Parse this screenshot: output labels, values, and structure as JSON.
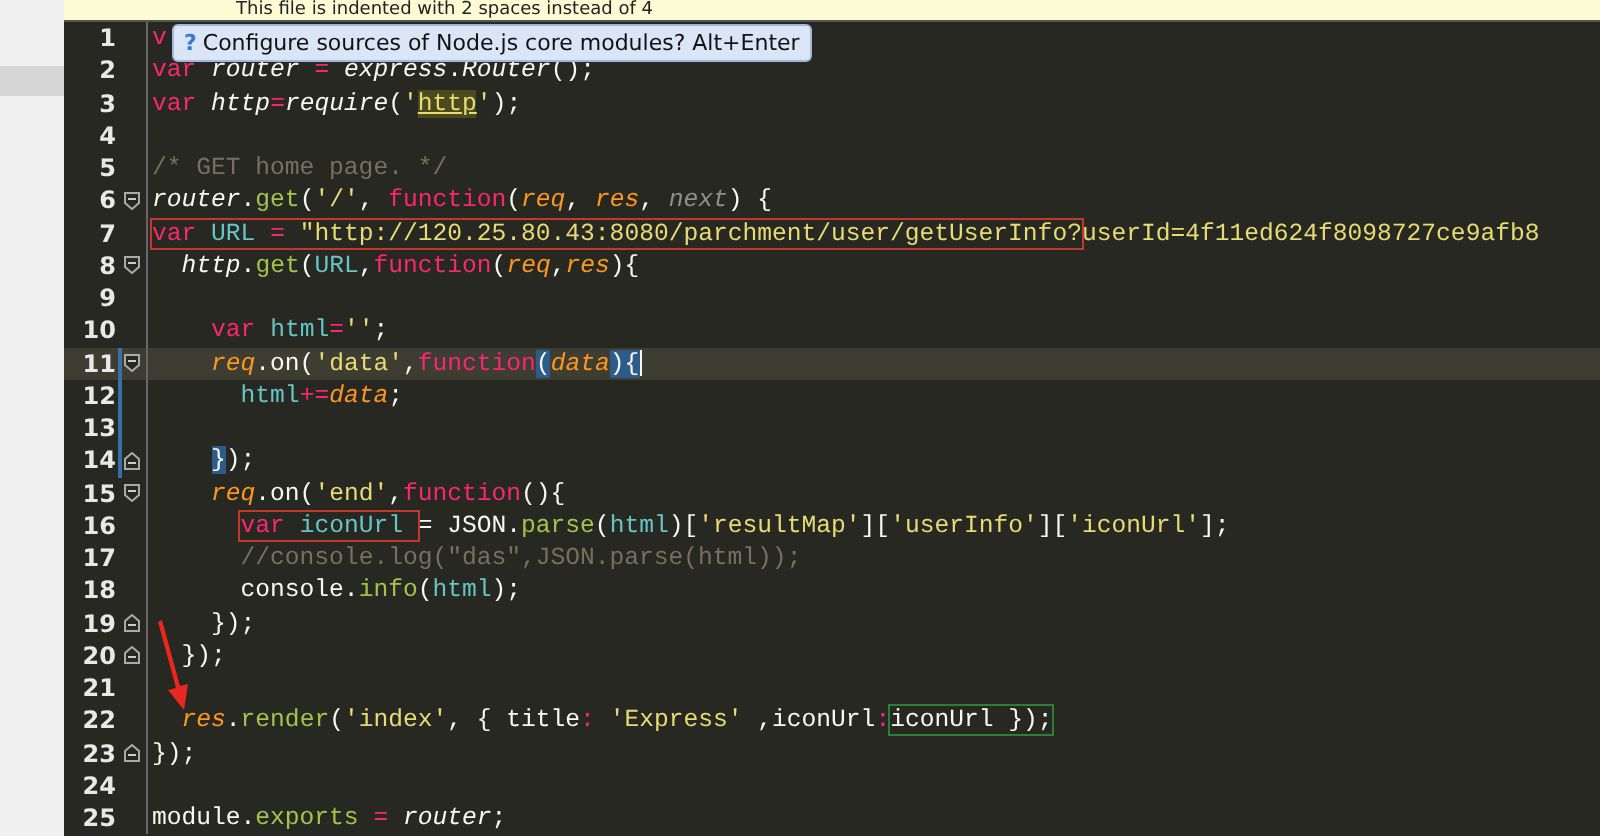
{
  "banner": {
    "text": "This file is indented with 2 spaces instead of 4"
  },
  "tooltip": {
    "icon": "?",
    "text": "Configure sources of Node.js core modules? Alt+Enter"
  },
  "lines": [
    {
      "number": "1",
      "current": false,
      "scope": false,
      "fold_open": false,
      "fold_close": false,
      "tokens": [
        {
          "kind": "kw",
          "text": "v"
        }
      ]
    },
    {
      "number": "2",
      "current": false,
      "scope": false,
      "fold_open": false,
      "fold_close": false,
      "tokens": [
        {
          "kind": "kw",
          "text": "var"
        },
        {
          "kind": "ivar",
          "text": " router"
        },
        {
          "kind": "op",
          "text": " ="
        },
        {
          "kind": "ivar",
          "text": " express"
        },
        {
          "kind": "plain",
          "text": "."
        },
        {
          "kind": "ivar",
          "text": "Router"
        },
        {
          "kind": "plain",
          "text": "();"
        }
      ]
    },
    {
      "number": "3",
      "current": false,
      "scope": false,
      "fold_open": false,
      "fold_close": false,
      "tokens": [
        {
          "kind": "kw",
          "text": "var"
        },
        {
          "kind": "ivar",
          "text": " http"
        },
        {
          "kind": "op",
          "text": "="
        },
        {
          "kind": "ivar",
          "text": "require"
        },
        {
          "kind": "plain",
          "text": "("
        },
        {
          "kind": "str",
          "text": "'"
        },
        {
          "kind": "usage",
          "text": "http"
        },
        {
          "kind": "str",
          "text": "'"
        },
        {
          "kind": "plain",
          "text": ");"
        }
      ]
    },
    {
      "number": "4",
      "current": false,
      "scope": false,
      "fold_open": false,
      "fold_close": false
    },
    {
      "number": "5",
      "current": false,
      "scope": false,
      "fold_open": false,
      "fold_close": false,
      "tokens": [
        {
          "kind": "cmt",
          "text": "/* GET home page. */"
        }
      ]
    },
    {
      "number": "6",
      "current": false,
      "scope": false,
      "fold_open": true,
      "fold_close": false,
      "tokens": [
        {
          "kind": "ivar",
          "text": "router"
        },
        {
          "kind": "plain",
          "text": "."
        },
        {
          "kind": "fn",
          "text": "get"
        },
        {
          "kind": "plain",
          "text": "("
        },
        {
          "kind": "str",
          "text": "'/'"
        },
        {
          "kind": "plain",
          "text": ", "
        },
        {
          "kind": "kw",
          "text": "function"
        },
        {
          "kind": "plain",
          "text": "("
        },
        {
          "kind": "param",
          "text": "req"
        },
        {
          "kind": "plain",
          "text": ", "
        },
        {
          "kind": "param",
          "text": "res"
        },
        {
          "kind": "plain",
          "text": ", "
        },
        {
          "kind": "unused",
          "text": "next"
        },
        {
          "kind": "plain",
          "text": ") {"
        }
      ]
    },
    {
      "number": "7",
      "current": false,
      "scope": false,
      "fold_open": false,
      "fold_close": false,
      "tokens": [
        {
          "kind": "box",
          "color": "#c0392b",
          "tokens": [
            {
              "kind": "kw",
              "text": "var"
            },
            {
              "kind": "var",
              "text": " URL"
            },
            {
              "kind": "op",
              "text": " ="
            },
            {
              "kind": "str",
              "text": " \"http://120.25.80.43:8080/parchment/user/getUserInfo?"
            }
          ]
        },
        {
          "kind": "str",
          "text": "userId=4f11ed624f8098727ce9afb8"
        }
      ]
    },
    {
      "number": "8",
      "current": false,
      "scope": false,
      "fold_open": true,
      "fold_close": false,
      "tokens": [
        {
          "kind": "ivar",
          "text": "  http"
        },
        {
          "kind": "plain",
          "text": "."
        },
        {
          "kind": "fn",
          "text": "get"
        },
        {
          "kind": "plain",
          "text": "("
        },
        {
          "kind": "var",
          "text": "URL"
        },
        {
          "kind": "plain",
          "text": ","
        },
        {
          "kind": "kw",
          "text": "function"
        },
        {
          "kind": "plain",
          "text": "("
        },
        {
          "kind": "param",
          "text": "req"
        },
        {
          "kind": "plain",
          "text": ","
        },
        {
          "kind": "param",
          "text": "res"
        },
        {
          "kind": "plain",
          "text": "){"
        }
      ]
    },
    {
      "number": "9",
      "current": false,
      "scope": false,
      "fold_open": false,
      "fold_close": false
    },
    {
      "number": "10",
      "current": false,
      "scope": false,
      "fold_open": false,
      "fold_close": false,
      "tokens": [
        {
          "kind": "kw",
          "text": "    var"
        },
        {
          "kind": "var",
          "text": " html"
        },
        {
          "kind": "op",
          "text": "="
        },
        {
          "kind": "str",
          "text": "''"
        },
        {
          "kind": "plain",
          "text": ";"
        }
      ]
    },
    {
      "number": "11",
      "current": true,
      "scope": true,
      "fold_open": true,
      "fold_close": false,
      "tokens": [
        {
          "kind": "param",
          "text": "    req"
        },
        {
          "kind": "plain",
          "text": ".on("
        },
        {
          "kind": "str",
          "text": "'data'"
        },
        {
          "kind": "plain",
          "text": ","
        },
        {
          "kind": "kw",
          "text": "function"
        },
        {
          "kind": "match",
          "text": "("
        },
        {
          "kind": "param",
          "text": "data"
        },
        {
          "kind": "match",
          "text": ")"
        },
        {
          "kind": "match",
          "text": "{"
        },
        {
          "kind": "caret"
        }
      ]
    },
    {
      "number": "12",
      "current": false,
      "scope": true,
      "fold_open": false,
      "fold_close": false,
      "tokens": [
        {
          "kind": "var",
          "text": "      html"
        },
        {
          "kind": "op",
          "text": "+="
        },
        {
          "kind": "param",
          "text": "data"
        },
        {
          "kind": "plain",
          "text": ";"
        }
      ]
    },
    {
      "number": "13",
      "current": false,
      "scope": true,
      "fold_open": false,
      "fold_close": false
    },
    {
      "number": "14",
      "current": false,
      "scope": true,
      "fold_open": false,
      "fold_close": true,
      "tokens": [
        {
          "kind": "match",
          "text": "    }"
        },
        {
          "kind": "plain",
          "text": ");"
        }
      ]
    },
    {
      "number": "15",
      "current": false,
      "scope": false,
      "fold_open": true,
      "fold_close": false,
      "tokens": [
        {
          "kind": "param",
          "text": "    req"
        },
        {
          "kind": "plain",
          "text": ".on("
        },
        {
          "kind": "str",
          "text": "'end'"
        },
        {
          "kind": "plain",
          "text": ","
        },
        {
          "kind": "kw",
          "text": "function"
        },
        {
          "kind": "plain",
          "text": "(){"
        }
      ]
    },
    {
      "number": "16",
      "current": false,
      "scope": false,
      "fold_open": false,
      "fold_close": false,
      "tokens": [
        {
          "kind": "box",
          "color": "#c0392b",
          "tokens": [
            {
              "kind": "kw",
              "text": "      var"
            },
            {
              "kind": "var",
              "text": " iconUrl "
            }
          ]
        },
        {
          "kind": "plain",
          "text": "= JSON."
        },
        {
          "kind": "fn",
          "text": "parse"
        },
        {
          "kind": "plain",
          "text": "("
        },
        {
          "kind": "var",
          "text": "html"
        },
        {
          "kind": "plain",
          "text": ")["
        },
        {
          "kind": "str",
          "text": "'resultMap'"
        },
        {
          "kind": "plain",
          "text": "]["
        },
        {
          "kind": "str",
          "text": "'userInfo'"
        },
        {
          "kind": "plain",
          "text": "]["
        },
        {
          "kind": "str",
          "text": "'iconUrl'"
        },
        {
          "kind": "plain",
          "text": "];"
        }
      ]
    },
    {
      "number": "17",
      "current": false,
      "scope": false,
      "fold_open": false,
      "fold_close": false,
      "tokens": [
        {
          "kind": "cmt",
          "text": "      //console.log(\"das\",JSON.parse(html));"
        }
      ]
    },
    {
      "number": "18",
      "current": false,
      "scope": false,
      "fold_open": false,
      "fold_close": false,
      "tokens": [
        {
          "kind": "plain",
          "text": "      console."
        },
        {
          "kind": "fn",
          "text": "info"
        },
        {
          "kind": "plain",
          "text": "("
        },
        {
          "kind": "var",
          "text": "html"
        },
        {
          "kind": "plain",
          "text": ");"
        }
      ]
    },
    {
      "number": "19",
      "current": false,
      "scope": false,
      "fold_open": false,
      "fold_close": true,
      "tokens": [
        {
          "kind": "plain",
          "text": "    });"
        }
      ]
    },
    {
      "number": "20",
      "current": false,
      "scope": false,
      "fold_open": false,
      "fold_close": true,
      "tokens": [
        {
          "kind": "plain",
          "text": "  });"
        }
      ]
    },
    {
      "number": "21",
      "current": false,
      "scope": false,
      "fold_open": false,
      "fold_close": false
    },
    {
      "number": "22",
      "current": false,
      "scope": false,
      "fold_open": false,
      "fold_close": false,
      "tokens": [
        {
          "kind": "param",
          "text": "  res"
        },
        {
          "kind": "plain",
          "text": "."
        },
        {
          "kind": "fn",
          "text": "render"
        },
        {
          "kind": "plain",
          "text": "("
        },
        {
          "kind": "str",
          "text": "'index'"
        },
        {
          "kind": "plain",
          "text": ", { title"
        },
        {
          "kind": "op",
          "text": ":"
        },
        {
          "kind": "str",
          "text": " 'Express'"
        },
        {
          "kind": "plain",
          "text": " ,iconUrl"
        },
        {
          "kind": "op",
          "text": ":"
        },
        {
          "kind": "box",
          "color": "#2e7d32",
          "tokens": [
            {
              "kind": "plain",
              "text": "iconUrl });"
            }
          ]
        }
      ]
    },
    {
      "number": "23",
      "current": false,
      "scope": false,
      "fold_open": false,
      "fold_close": true,
      "tokens": [
        {
          "kind": "plain",
          "text": "});"
        }
      ]
    },
    {
      "number": "24",
      "current": false,
      "scope": false,
      "fold_open": false,
      "fold_close": false
    },
    {
      "number": "25",
      "current": false,
      "scope": false,
      "fold_open": false,
      "fold_close": false,
      "tokens": [
        {
          "kind": "plain",
          "text": "module."
        },
        {
          "kind": "fn",
          "text": "exports"
        },
        {
          "kind": "op",
          "text": " ="
        },
        {
          "kind": "ivar",
          "text": " router"
        },
        {
          "kind": "plain",
          "text": ";"
        }
      ]
    }
  ]
}
